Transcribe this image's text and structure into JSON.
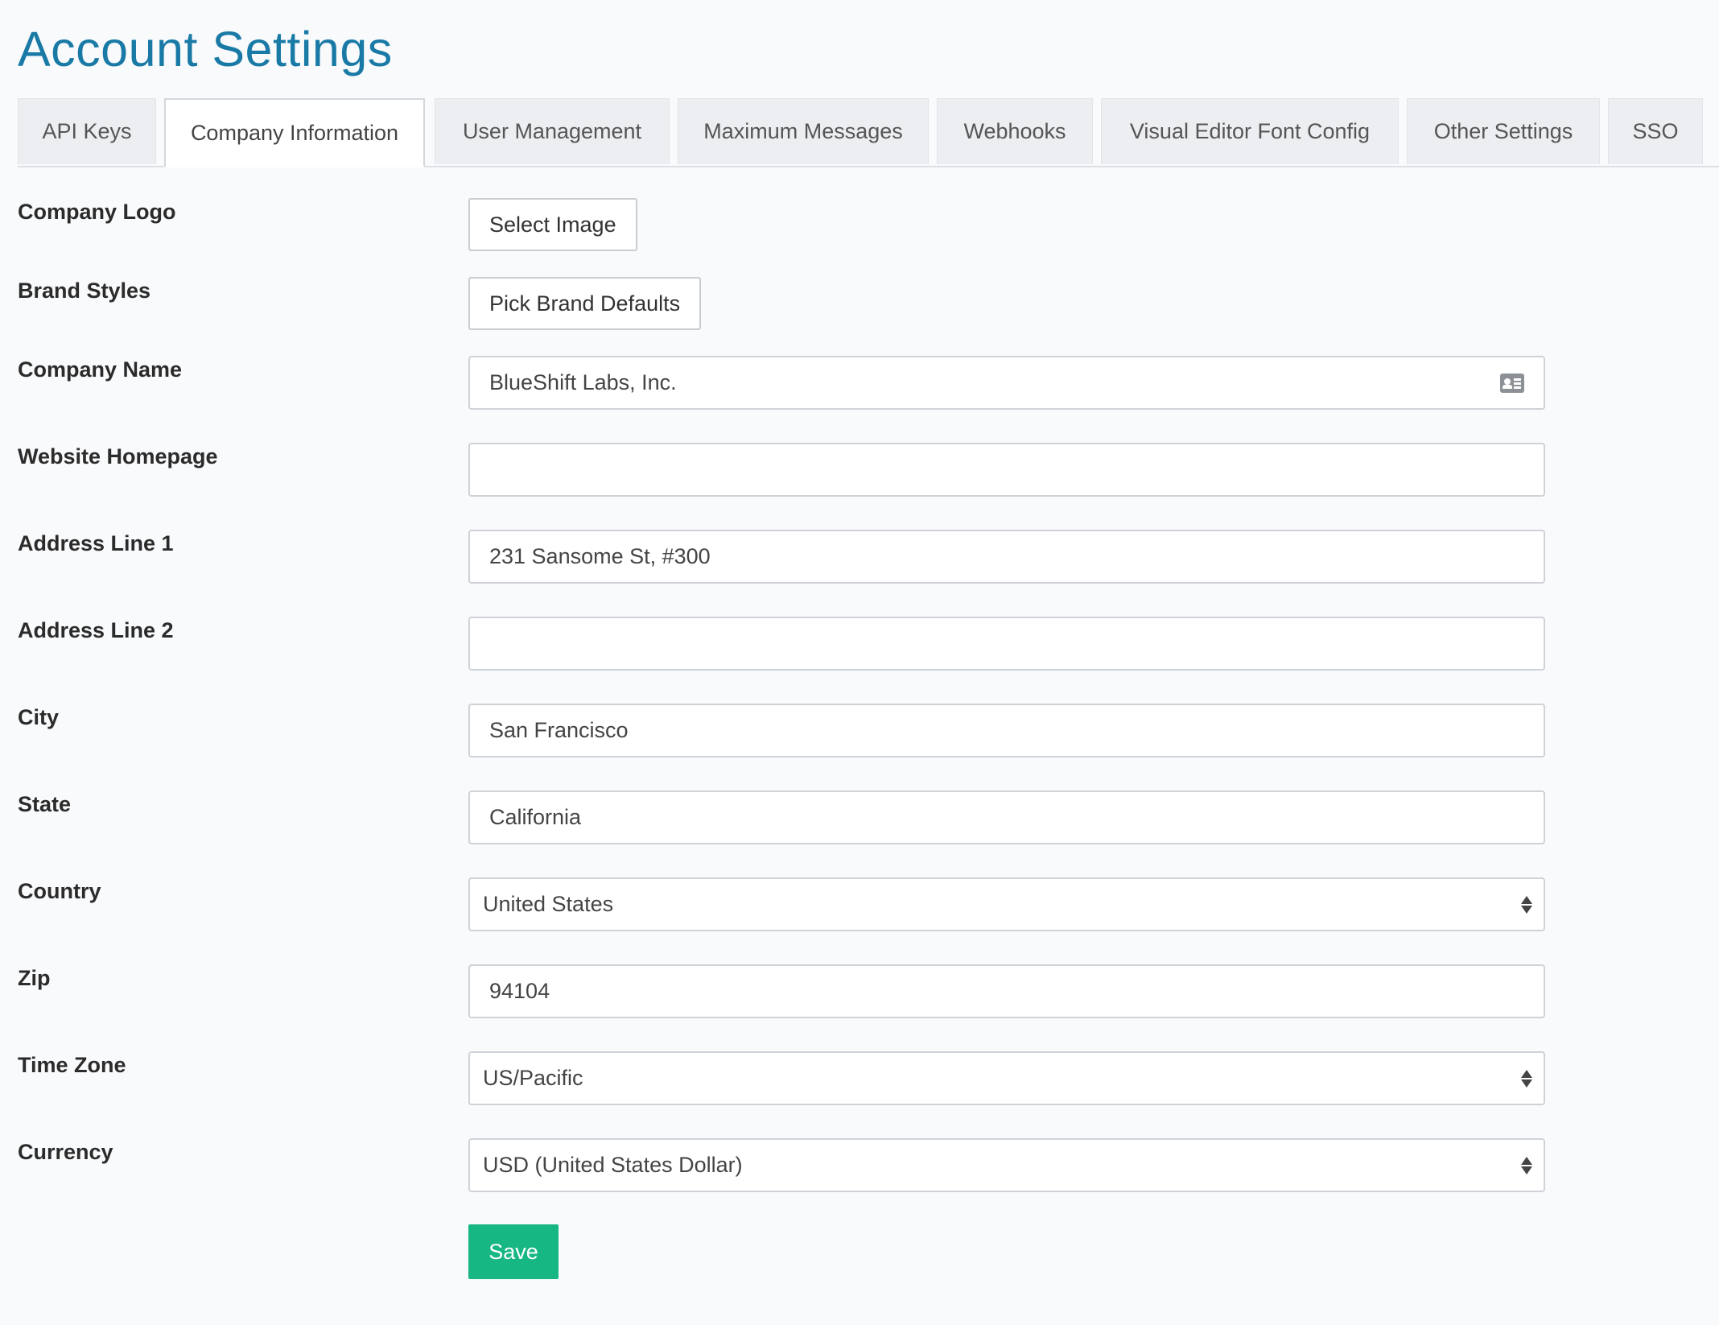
{
  "page": {
    "title": "Account Settings"
  },
  "tabs": [
    {
      "label": "API Keys"
    },
    {
      "label": "Company Information",
      "active": true
    },
    {
      "label": "User Management"
    },
    {
      "label": "Maximum Messages"
    },
    {
      "label": "Webhooks"
    },
    {
      "label": "Visual Editor Font Config"
    },
    {
      "label": "Other Settings"
    },
    {
      "label": "SSO"
    }
  ],
  "form": {
    "company_logo": {
      "label": "Company Logo",
      "button": "Select Image"
    },
    "brand_styles": {
      "label": "Brand Styles",
      "button": "Pick Brand Defaults"
    },
    "company_name": {
      "label": "Company Name",
      "value": "BlueShift Labs, Inc.",
      "icon": "contact-card-icon"
    },
    "website_homepage": {
      "label": "Website Homepage",
      "value": ""
    },
    "address_line_1": {
      "label": "Address Line 1",
      "value": "231 Sansome St, #300"
    },
    "address_line_2": {
      "label": "Address Line 2",
      "value": ""
    },
    "city": {
      "label": "City",
      "value": "San Francisco"
    },
    "state": {
      "label": "State",
      "value": "California"
    },
    "country": {
      "label": "Country",
      "value": "United States"
    },
    "zip": {
      "label": "Zip",
      "value": "94104"
    },
    "time_zone": {
      "label": "Time Zone",
      "value": "US/Pacific"
    },
    "currency": {
      "label": "Currency",
      "value": "USD (United States Dollar)"
    },
    "save_label": "Save"
  },
  "colors": {
    "title": "#1a7aa6",
    "save_button": "#17b784",
    "background": "#f9fafc"
  }
}
